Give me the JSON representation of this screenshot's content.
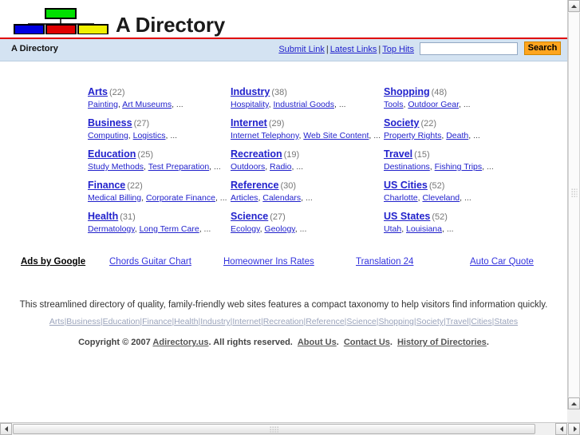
{
  "header": {
    "site_title": "A Directory",
    "logo_icon": "directory-tree-logo",
    "logo_colors": {
      "top": "#00e000",
      "left": "#0000e0",
      "middle": "#e00000",
      "right": "#f0f000",
      "stroke": "#000000"
    },
    "rule_color": "#e00000"
  },
  "navbar": {
    "brand": "A Directory",
    "background": "#d4e3f2",
    "links": [
      {
        "label": "Submit Link"
      },
      {
        "label": "Latest Links"
      },
      {
        "label": "Top Hits"
      }
    ],
    "separator": "|",
    "search": {
      "value": "",
      "placeholder": "",
      "button_label": "Search",
      "button_color": "#ffa51f"
    }
  },
  "categories": {
    "columns": [
      {
        "blocks": [
          {
            "name": "Arts",
            "count": "(22)",
            "subs": [
              "Painting",
              "Art Museums"
            ],
            "more": "..."
          },
          {
            "name": "Business",
            "count": "(27)",
            "subs": [
              "Computing",
              "Logistics"
            ],
            "more": "..."
          },
          {
            "name": "Education",
            "count": "(25)",
            "subs": [
              "Study Methods",
              "Test Preparation"
            ],
            "more": "..."
          },
          {
            "name": "Finance",
            "count": "(22)",
            "subs": [
              "Medical Billing",
              "Corporate Finance"
            ],
            "more": "..."
          },
          {
            "name": "Health",
            "count": "(31)",
            "subs": [
              "Dermatology",
              "Long Term Care"
            ],
            "more": "..."
          }
        ]
      },
      {
        "blocks": [
          {
            "name": "Industry",
            "count": "(38)",
            "subs": [
              "Hospitality",
              "Industrial Goods"
            ],
            "more": "..."
          },
          {
            "name": "Internet",
            "count": "(29)",
            "subs": [
              "Internet Telephony",
              "Web Site Content"
            ],
            "more": "..."
          },
          {
            "name": "Recreation",
            "count": "(19)",
            "subs": [
              "Outdoors",
              "Radio"
            ],
            "more": "..."
          },
          {
            "name": "Reference",
            "count": "(30)",
            "subs": [
              "Articles",
              "Calendars"
            ],
            "more": "..."
          },
          {
            "name": "Science",
            "count": "(27)",
            "subs": [
              "Ecology",
              "Geology"
            ],
            "more": "..."
          }
        ]
      },
      {
        "blocks": [
          {
            "name": "Shopping",
            "count": "(48)",
            "subs": [
              "Tools",
              "Outdoor Gear"
            ],
            "more": "..."
          },
          {
            "name": "Society",
            "count": "(22)",
            "subs": [
              "Property Rights",
              "Death"
            ],
            "more": "..."
          },
          {
            "name": "Travel",
            "count": "(15)",
            "subs": [
              "Destinations",
              "Fishing Trips"
            ],
            "more": "..."
          },
          {
            "name": "US Cities",
            "count": "(52)",
            "subs": [
              "Charlotte",
              "Cleveland"
            ],
            "more": "..."
          },
          {
            "name": "US States",
            "count": "(52)",
            "subs": [
              "Utah",
              "Louisiana"
            ],
            "more": "..."
          }
        ]
      }
    ]
  },
  "ads": {
    "label": "Ads by Google",
    "links": [
      "Chords Guitar Chart",
      "Homeowner Ins Rates",
      "Translation 24",
      "Auto Car Quote"
    ]
  },
  "footer": {
    "description": "This streamlined directory of quality, family-friendly web sites features a compact taxonomy to help visitors find information quickly.",
    "category_links": [
      "Arts",
      "Business",
      "Education",
      "Finance",
      "Health",
      "Industry",
      "Internet",
      "Recreation",
      "Reference",
      "Science",
      "Shopping",
      "Society",
      "Travel",
      "Cities",
      "States"
    ],
    "category_separator": "|",
    "copyright_prefix": "Copyright © 2007",
    "copyright_site": "Adirectory.us",
    "copyright_rights": ".  All rights reserved.",
    "bottom_links": [
      "About Us",
      "Contact Us",
      "History of Directories"
    ],
    "bottom_link_suffix": "."
  },
  "scrollbars": {
    "vertical_icon": "scrollbar-vertical",
    "horizontal_icon": "scrollbar-horizontal",
    "up_arrow": "▲",
    "down_arrow": "▼",
    "left_arrow": "◀",
    "right_arrow": "▶"
  }
}
